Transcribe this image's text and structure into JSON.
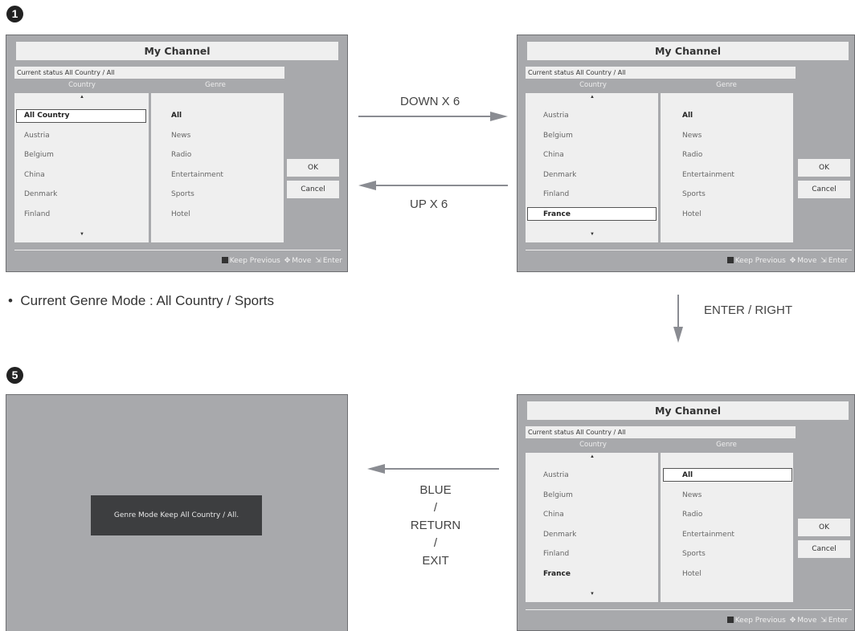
{
  "badges": {
    "first": "1",
    "second": "5"
  },
  "screens": [
    {
      "title": "My Channel",
      "status": "Current status All Country / All",
      "country_header": "Country",
      "genre_header": "Genre",
      "countries": [
        "All Country",
        "Austria",
        "Belgium",
        "China",
        "Denmark",
        "Finland"
      ],
      "genres": [
        "All",
        "News",
        "Radio",
        "Entertainment",
        "Sports",
        "Hotel"
      ],
      "ok": "OK",
      "cancel": "Cancel",
      "footer": {
        "keep": "Keep Previous",
        "move": "Move",
        "enter": "Enter"
      }
    },
    {
      "title": "My Channel",
      "status": "Current status All Country / All",
      "country_header": "Country",
      "genre_header": "Genre",
      "countries": [
        "Austria",
        "Belgium",
        "China",
        "Denmark",
        "Finland",
        "France"
      ],
      "genres": [
        "All",
        "News",
        "Radio",
        "Entertainment",
        "Sports",
        "Hotel"
      ],
      "ok": "OK",
      "cancel": "Cancel",
      "footer": {
        "keep": "Keep Previous",
        "move": "Move",
        "enter": "Enter"
      }
    },
    {
      "title": "My Channel",
      "status": "Current status All Country / All",
      "country_header": "Country",
      "genre_header": "Genre",
      "countries": [
        "Austria",
        "Belgium",
        "China",
        "Denmark",
        "Finland",
        "France"
      ],
      "genres": [
        "All",
        "News",
        "Radio",
        "Entertainment",
        "Sports",
        "Hotel"
      ],
      "ok": "OK",
      "cancel": "Cancel",
      "footer": {
        "keep": "Keep Previous",
        "move": "Move",
        "enter": "Enter"
      }
    }
  ],
  "transitions": {
    "down": "DOWN X 6",
    "up": "UP X 6",
    "enter_right": "ENTER / RIGHT",
    "blue": "BLUE",
    "slash1": "/",
    "return": "RETURN",
    "slash2": "/",
    "exit": "EXIT"
  },
  "note": "Current Genre Mode : All Country / Sports",
  "message": "Genre Mode Keep All Country / All.",
  "icons": {
    "keep": "blue-key-icon",
    "move": "move-cross-icon",
    "enter": "enter-icon",
    "scroll_up": "triangle-up-icon",
    "scroll_down": "triangle-down-icon"
  }
}
